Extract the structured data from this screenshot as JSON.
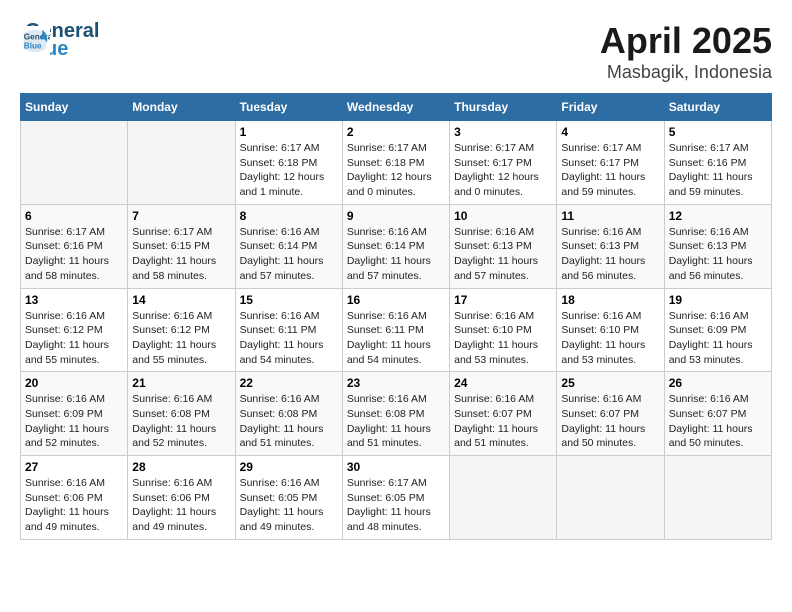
{
  "logo": {
    "line1": "General",
    "line2": "Blue"
  },
  "title": "April 2025",
  "subtitle": "Masbagik, Indonesia",
  "days_of_week": [
    "Sunday",
    "Monday",
    "Tuesday",
    "Wednesday",
    "Thursday",
    "Friday",
    "Saturday"
  ],
  "weeks": [
    [
      {
        "day": "",
        "info": ""
      },
      {
        "day": "",
        "info": ""
      },
      {
        "day": "1",
        "info": "Sunrise: 6:17 AM\nSunset: 6:18 PM\nDaylight: 12 hours and 1 minute."
      },
      {
        "day": "2",
        "info": "Sunrise: 6:17 AM\nSunset: 6:18 PM\nDaylight: 12 hours and 0 minutes."
      },
      {
        "day": "3",
        "info": "Sunrise: 6:17 AM\nSunset: 6:17 PM\nDaylight: 12 hours and 0 minutes."
      },
      {
        "day": "4",
        "info": "Sunrise: 6:17 AM\nSunset: 6:17 PM\nDaylight: 11 hours and 59 minutes."
      },
      {
        "day": "5",
        "info": "Sunrise: 6:17 AM\nSunset: 6:16 PM\nDaylight: 11 hours and 59 minutes."
      }
    ],
    [
      {
        "day": "6",
        "info": "Sunrise: 6:17 AM\nSunset: 6:16 PM\nDaylight: 11 hours and 58 minutes."
      },
      {
        "day": "7",
        "info": "Sunrise: 6:17 AM\nSunset: 6:15 PM\nDaylight: 11 hours and 58 minutes."
      },
      {
        "day": "8",
        "info": "Sunrise: 6:16 AM\nSunset: 6:14 PM\nDaylight: 11 hours and 57 minutes."
      },
      {
        "day": "9",
        "info": "Sunrise: 6:16 AM\nSunset: 6:14 PM\nDaylight: 11 hours and 57 minutes."
      },
      {
        "day": "10",
        "info": "Sunrise: 6:16 AM\nSunset: 6:13 PM\nDaylight: 11 hours and 57 minutes."
      },
      {
        "day": "11",
        "info": "Sunrise: 6:16 AM\nSunset: 6:13 PM\nDaylight: 11 hours and 56 minutes."
      },
      {
        "day": "12",
        "info": "Sunrise: 6:16 AM\nSunset: 6:13 PM\nDaylight: 11 hours and 56 minutes."
      }
    ],
    [
      {
        "day": "13",
        "info": "Sunrise: 6:16 AM\nSunset: 6:12 PM\nDaylight: 11 hours and 55 minutes."
      },
      {
        "day": "14",
        "info": "Sunrise: 6:16 AM\nSunset: 6:12 PM\nDaylight: 11 hours and 55 minutes."
      },
      {
        "day": "15",
        "info": "Sunrise: 6:16 AM\nSunset: 6:11 PM\nDaylight: 11 hours and 54 minutes."
      },
      {
        "day": "16",
        "info": "Sunrise: 6:16 AM\nSunset: 6:11 PM\nDaylight: 11 hours and 54 minutes."
      },
      {
        "day": "17",
        "info": "Sunrise: 6:16 AM\nSunset: 6:10 PM\nDaylight: 11 hours and 53 minutes."
      },
      {
        "day": "18",
        "info": "Sunrise: 6:16 AM\nSunset: 6:10 PM\nDaylight: 11 hours and 53 minutes."
      },
      {
        "day": "19",
        "info": "Sunrise: 6:16 AM\nSunset: 6:09 PM\nDaylight: 11 hours and 53 minutes."
      }
    ],
    [
      {
        "day": "20",
        "info": "Sunrise: 6:16 AM\nSunset: 6:09 PM\nDaylight: 11 hours and 52 minutes."
      },
      {
        "day": "21",
        "info": "Sunrise: 6:16 AM\nSunset: 6:08 PM\nDaylight: 11 hours and 52 minutes."
      },
      {
        "day": "22",
        "info": "Sunrise: 6:16 AM\nSunset: 6:08 PM\nDaylight: 11 hours and 51 minutes."
      },
      {
        "day": "23",
        "info": "Sunrise: 6:16 AM\nSunset: 6:08 PM\nDaylight: 11 hours and 51 minutes."
      },
      {
        "day": "24",
        "info": "Sunrise: 6:16 AM\nSunset: 6:07 PM\nDaylight: 11 hours and 51 minutes."
      },
      {
        "day": "25",
        "info": "Sunrise: 6:16 AM\nSunset: 6:07 PM\nDaylight: 11 hours and 50 minutes."
      },
      {
        "day": "26",
        "info": "Sunrise: 6:16 AM\nSunset: 6:07 PM\nDaylight: 11 hours and 50 minutes."
      }
    ],
    [
      {
        "day": "27",
        "info": "Sunrise: 6:16 AM\nSunset: 6:06 PM\nDaylight: 11 hours and 49 minutes."
      },
      {
        "day": "28",
        "info": "Sunrise: 6:16 AM\nSunset: 6:06 PM\nDaylight: 11 hours and 49 minutes."
      },
      {
        "day": "29",
        "info": "Sunrise: 6:16 AM\nSunset: 6:05 PM\nDaylight: 11 hours and 49 minutes."
      },
      {
        "day": "30",
        "info": "Sunrise: 6:17 AM\nSunset: 6:05 PM\nDaylight: 11 hours and 48 minutes."
      },
      {
        "day": "",
        "info": ""
      },
      {
        "day": "",
        "info": ""
      },
      {
        "day": "",
        "info": ""
      }
    ]
  ]
}
